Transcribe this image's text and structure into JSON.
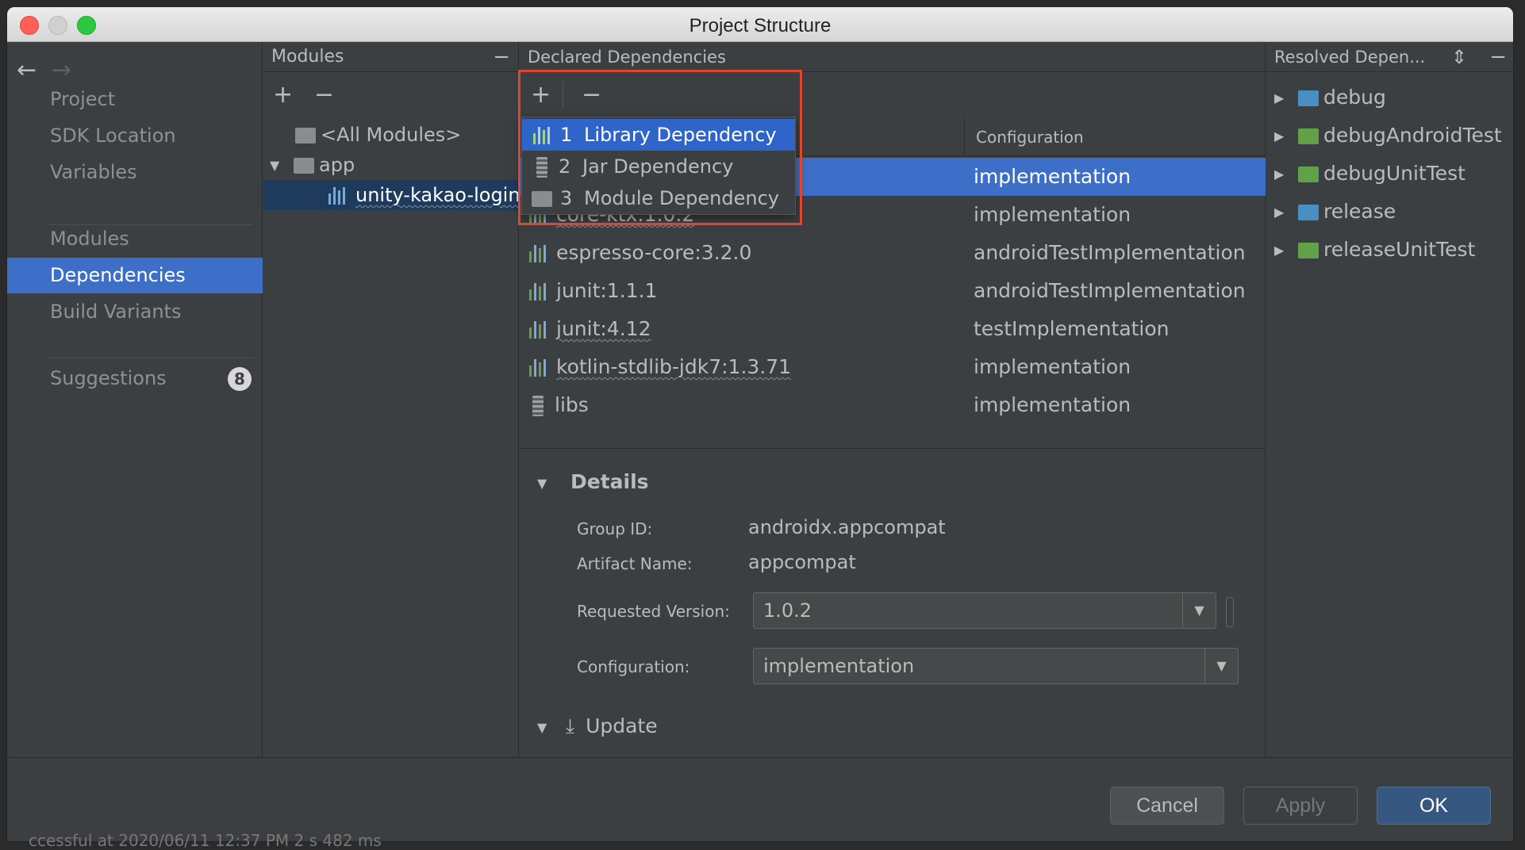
{
  "window": {
    "title": "Project Structure"
  },
  "nav": {
    "back_icon": "←",
    "forward_icon": "→",
    "items": [
      "Project",
      "SDK Location",
      "Variables",
      "Modules",
      "Dependencies",
      "Build Variants",
      "Suggestions"
    ],
    "suggestions_count": "8"
  },
  "modules": {
    "header": "Modules",
    "add": "+",
    "remove": "−",
    "tree": {
      "all": "<All Modules>",
      "app": "app",
      "child": "unity-kakao-login"
    }
  },
  "declared": {
    "header": "Declared Dependencies",
    "col_config": "Configuration",
    "popup": [
      {
        "num": "1",
        "label": "Library Dependency"
      },
      {
        "num": "2",
        "label": "Jar Dependency"
      },
      {
        "num": "3",
        "label": "Module Dependency"
      }
    ],
    "rows": [
      {
        "name": "",
        "config": "implementation"
      },
      {
        "name": "core-ktx:1.0.2",
        "config": "implementation"
      },
      {
        "name": "espresso-core:3.2.0",
        "config": "androidTestImplementation"
      },
      {
        "name": "junit:1.1.1",
        "config": "androidTestImplementation"
      },
      {
        "name": "junit:4.12",
        "config": "testImplementation"
      },
      {
        "name": "kotlin-stdlib-jdk7:1.3.71",
        "config": "implementation"
      },
      {
        "name": "libs",
        "config": "implementation"
      }
    ],
    "details": {
      "title": "Details",
      "group_label": "Group ID:",
      "group_value": "androidx.appcompat",
      "artifact_label": "Artifact Name:",
      "artifact_value": "appcompat",
      "version_label": "Requested Version:",
      "version_value": "1.0.2",
      "config_label": "Configuration:",
      "config_value": "implementation"
    },
    "update": "Update"
  },
  "resolved": {
    "header": "Resolved Depen...",
    "items": [
      "debug",
      "debugAndroidTest",
      "debugUnitTest",
      "release",
      "releaseUnitTest"
    ]
  },
  "buttons": {
    "cancel": "Cancel",
    "apply": "Apply",
    "ok": "OK"
  },
  "status": "ccessful at 2020/06/11 12:37 PM        2 s 482 ms"
}
